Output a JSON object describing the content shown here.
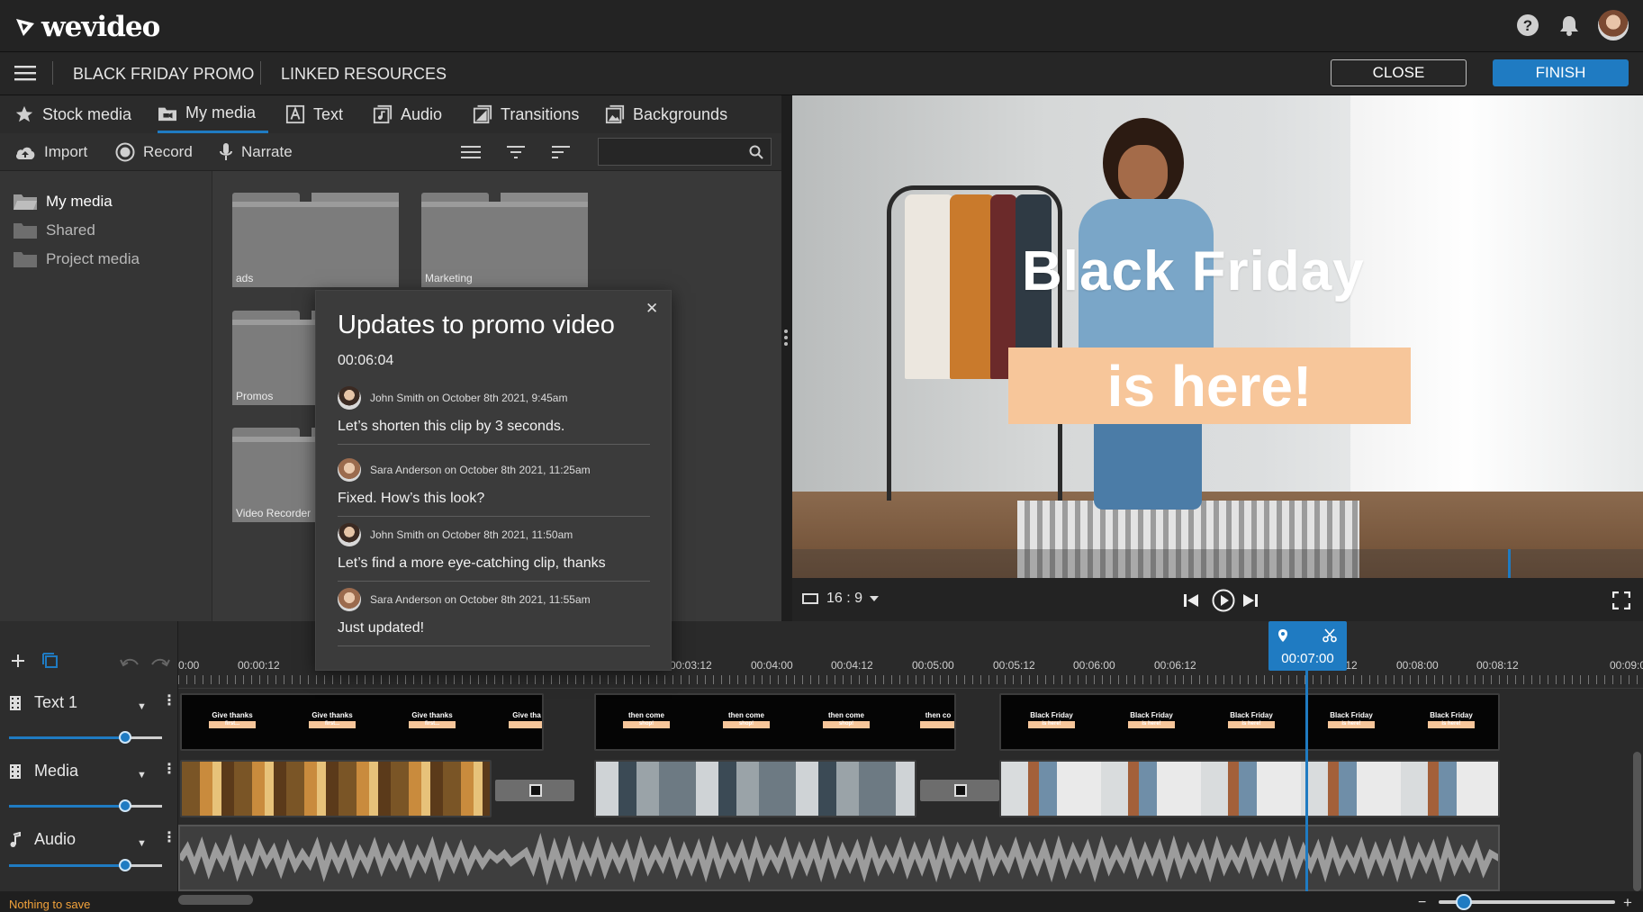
{
  "app": {
    "logo": "wevideo"
  },
  "project": {
    "title": "BLACK FRIDAY PROMO",
    "linked": "LINKED RESOURCES",
    "close_label": "CLOSE",
    "finish_label": "FINISH"
  },
  "library": {
    "tabs": [
      {
        "label": "Stock media",
        "icon": "star-icon"
      },
      {
        "label": "My media",
        "icon": "folder-camera-icon",
        "active": true
      },
      {
        "label": "Text",
        "icon": "text-icon"
      },
      {
        "label": "Audio",
        "icon": "audio-icon"
      },
      {
        "label": "Transitions",
        "icon": "transitions-icon"
      },
      {
        "label": "Backgrounds",
        "icon": "backgrounds-icon"
      }
    ],
    "tools": {
      "import": "Import",
      "record": "Record",
      "narrate": "Narrate",
      "search_placeholder": ""
    },
    "sidebar": [
      "My media",
      "Shared",
      "Project media"
    ],
    "folders": [
      "ads",
      "Marketing",
      "Promos",
      "Video Recorder"
    ]
  },
  "preview": {
    "title_line1": "Black Friday",
    "title_line2": "is here!",
    "title_box_color": "#f7c69a",
    "aspect_ratio": "16 : 9"
  },
  "timeline": {
    "ruler": [
      "0:00",
      "00:00:12",
      "00:03:12",
      "00:04:00",
      "00:04:12",
      "00:05:00",
      "00:05:12",
      "00:06:00",
      "00:06:12",
      "00:07:12",
      "00:08:00",
      "00:08:12",
      "00:09:0"
    ],
    "playhead_time": "00:07:00",
    "tracks": [
      {
        "name": "Text 1"
      },
      {
        "name": "Media"
      },
      {
        "name": "Audio"
      }
    ],
    "text_clips": {
      "clip1": {
        "title": "Give thanks",
        "sub": "first..."
      },
      "clip1_cut": "Give tha",
      "clip2": {
        "title": "then come",
        "sub": "shop!"
      },
      "clip2_cut": "then co",
      "clip3": {
        "title": "Black Friday",
        "sub": "is here!"
      }
    },
    "status": "Nothing to save"
  },
  "popup": {
    "title": "Updates to promo video",
    "time": "00:06:04",
    "comments": [
      {
        "author": "John Smith on October 8th 2021, 9:45am",
        "text": "Let’s shorten this clip by 3 seconds."
      },
      {
        "author": "Sara Anderson on October 8th 2021, 11:25am",
        "text": "Fixed. How’s this look?"
      },
      {
        "author": "John Smith on October 8th 2021, 11:50am",
        "text": "Let’s find a more eye-catching clip, thanks"
      },
      {
        "author": "Sara Anderson on October 8th 2021, 11:55am",
        "text": "Just updated!"
      }
    ]
  },
  "colors": {
    "accent": "#1f7bc2",
    "status": "#f3a33b"
  }
}
